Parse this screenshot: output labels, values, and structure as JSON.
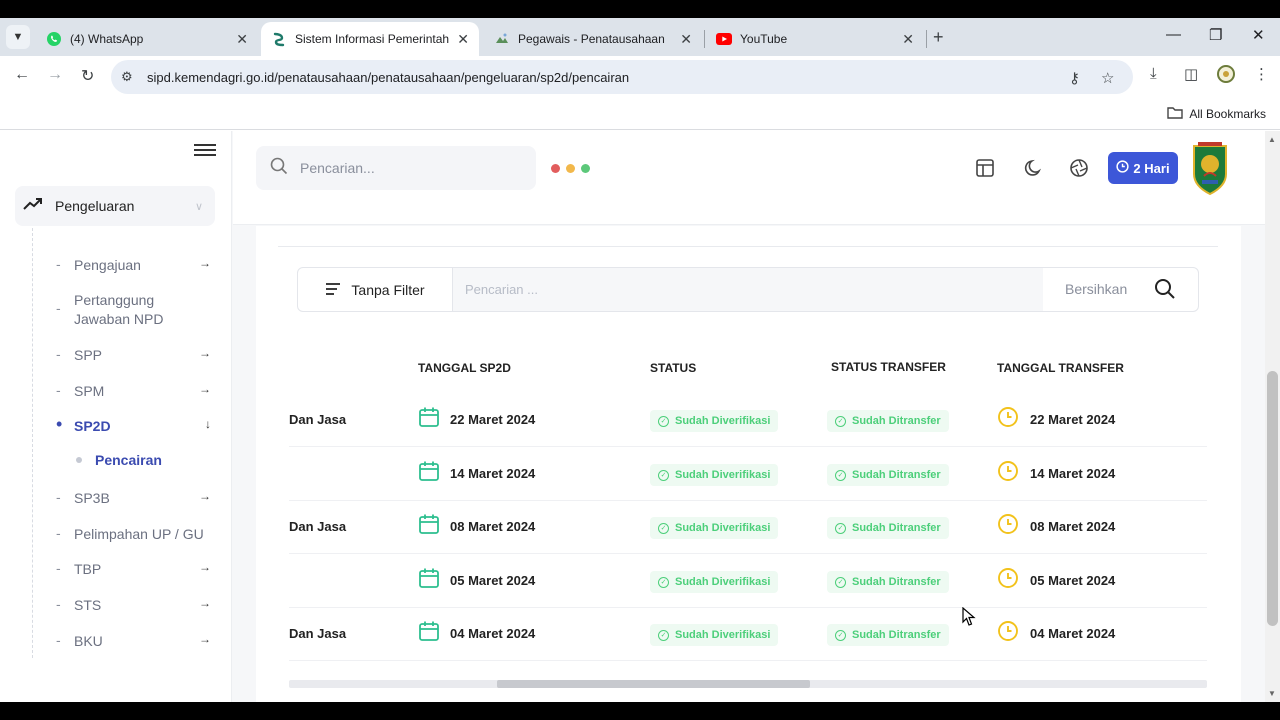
{
  "browser": {
    "tabs": [
      {
        "title": "(4) WhatsApp",
        "icon": "whatsapp-icon",
        "active": false
      },
      {
        "title": "Sistem Informasi Pemerintahan",
        "icon": "sipd-icon",
        "active": true
      },
      {
        "title": "Pegawais - Penatausahaan",
        "icon": "pegawai-icon",
        "active": false
      },
      {
        "title": "YouTube",
        "icon": "youtube-icon",
        "active": false
      }
    ],
    "url": "sipd.kemendagri.go.id/penatausahaan/penatausahaan/pengeluaran/sp2d/pencairan",
    "bookmarks_label": "All Bookmarks"
  },
  "header": {
    "search_placeholder": "Pencarian...",
    "dot_colors": [
      "#e25d5d",
      "#f2b84b",
      "#5cc87a"
    ],
    "days_label": "2 Hari"
  },
  "sidebar": {
    "section": "Pengeluaran",
    "items": [
      {
        "label": "Pengajuan",
        "arrow": true
      },
      {
        "label": "Pertanggung Jawaban NPD",
        "arrow": false
      },
      {
        "label": "SPP",
        "arrow": true
      },
      {
        "label": "SPM",
        "arrow": true
      },
      {
        "label": "SP2D",
        "arrow": true,
        "active": true
      },
      {
        "label": "SP3B",
        "arrow": true
      },
      {
        "label": "Pelimpahan UP / GU",
        "arrow": false
      },
      {
        "label": "TBP",
        "arrow": true
      },
      {
        "label": "STS",
        "arrow": true
      },
      {
        "label": "BKU",
        "arrow": true
      }
    ],
    "sub_item": "Pencairan"
  },
  "filter": {
    "button_label": "Tanpa Filter",
    "search_placeholder": "Pencarian ...",
    "clear_label": "Bersihkan"
  },
  "table": {
    "headers": {
      "tanggal_sp2d": "TANGGAL SP2D",
      "status": "STATUS",
      "status_transfer": "STATUS TRANSFER",
      "tanggal_transfer": "TANGGAL TRANSFER"
    },
    "rows": [
      {
        "jenis": "Dan Jasa",
        "tanggal": "22 Maret 2024",
        "status": "Sudah Diverifikasi",
        "transfer": "Sudah Ditransfer",
        "tanggal_transfer": "22 Maret 2024"
      },
      {
        "jenis": "",
        "tanggal": "14 Maret 2024",
        "status": "Sudah Diverifikasi",
        "transfer": "Sudah Ditransfer",
        "tanggal_transfer": "14 Maret 2024"
      },
      {
        "jenis": "Dan Jasa",
        "tanggal": "08 Maret 2024",
        "status": "Sudah Diverifikasi",
        "transfer": "Sudah Ditransfer",
        "tanggal_transfer": "08 Maret 2024"
      },
      {
        "jenis": "",
        "tanggal": "05 Maret 2024",
        "status": "Sudah Diverifikasi",
        "transfer": "Sudah Ditransfer",
        "tanggal_transfer": "05 Maret 2024"
      },
      {
        "jenis": "Dan Jasa",
        "tanggal": "04 Maret 2024",
        "status": "Sudah Diverifikasi",
        "transfer": "Sudah Ditransfer",
        "tanggal_transfer": "04 Maret 2024"
      }
    ]
  }
}
